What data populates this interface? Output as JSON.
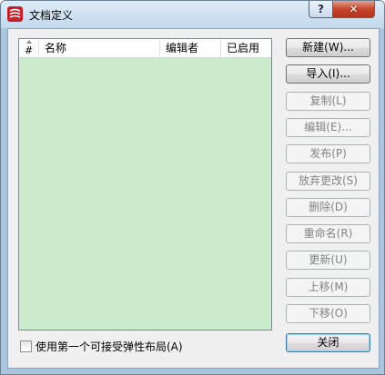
{
  "window": {
    "title": "文档定义",
    "help_label": "?",
    "close_label": "✕"
  },
  "listview": {
    "columns": [
      {
        "label": "#"
      },
      {
        "label": "名称"
      },
      {
        "label": "编辑者"
      },
      {
        "label": "已启用"
      }
    ],
    "rows": []
  },
  "buttons": {
    "new": "新建(W)...",
    "import": "导入(I)...",
    "copy": "复制(L)",
    "edit": "编辑(E)...",
    "publish": "发布(P)",
    "discard": "放弃更改(S)",
    "delete": "删除(D)",
    "rename": "重命名(R)",
    "update": "更新(U)",
    "move_up": "上移(M)",
    "move_down": "下移(O)",
    "close": "关闭"
  },
  "checkbox": {
    "label": "使用第一个可接受弹性布局(A)",
    "checked": false
  },
  "colors": {
    "list_background": "#cbebcd",
    "title_bar": "#c2d8ec",
    "close_button": "#c8442b"
  }
}
